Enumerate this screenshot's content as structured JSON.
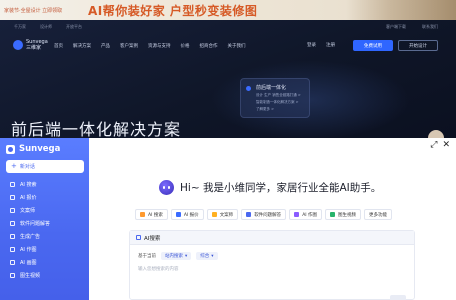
{
  "promo": {
    "small_text": "家装节·全屋设计 立即领取",
    "headline": "AI帮你装好家 户型秒变装修图"
  },
  "site": {
    "top_links": [
      "千万家",
      "设计师",
      "开放平台"
    ],
    "top_right": [
      "客户端下载",
      "联系我们"
    ],
    "logo_text": "Sunvega",
    "logo_sub": "三维家",
    "nav": [
      "首页",
      "解决方案",
      "产品",
      "客户案例",
      "资源与支持",
      "价格",
      "招商合作",
      "关于我们"
    ],
    "login": [
      "登录",
      "注册"
    ],
    "primary_btn": "免费试用",
    "secondary_btn": "开始设计",
    "card_title": "前后端一体化",
    "card_lines": [
      "设计 生产 销售全链路打通 >",
      "智能制造一体化解决方案 >",
      "了解更多 >"
    ],
    "hero": "前后端一体化解决方案"
  },
  "assistant": {
    "brand": "Sunvega",
    "new_chat": "新对话",
    "side_items": [
      {
        "label": "AI 搜索",
        "icon": "search-icon"
      },
      {
        "label": "AI 报价",
        "icon": "quote-icon"
      },
      {
        "label": "文案师",
        "icon": "document-icon"
      },
      {
        "label": "软件问题解答",
        "icon": "question-icon"
      },
      {
        "label": "生成广告",
        "icon": "megaphone-icon"
      },
      {
        "label": "AI 作图",
        "icon": "image-icon"
      },
      {
        "label": "AI 画图",
        "icon": "brush-icon"
      },
      {
        "label": "图生视频",
        "icon": "video-icon"
      }
    ],
    "greeting": "Hi~ 我是小维同学，家居行业全能AI助手。",
    "quick_actions": [
      {
        "label": "AI 搜索",
        "color": "#ff9a2e"
      },
      {
        "label": "AI 报价",
        "color": "#3a6bff"
      },
      {
        "label": "文案师",
        "color": "#ffb020"
      },
      {
        "label": "软件问题解答",
        "color": "#4a68f0"
      },
      {
        "label": "AI 作图",
        "color": "#8a5cff"
      },
      {
        "label": "图生视频",
        "color": "#27b36b"
      },
      {
        "label": "更多功能",
        "color": ""
      }
    ],
    "panel": {
      "title": "AI搜索",
      "row_label": "基于当前",
      "select1": "站内搜索",
      "select2": "综合",
      "placeholder": "输入您想搜索的内容"
    }
  }
}
